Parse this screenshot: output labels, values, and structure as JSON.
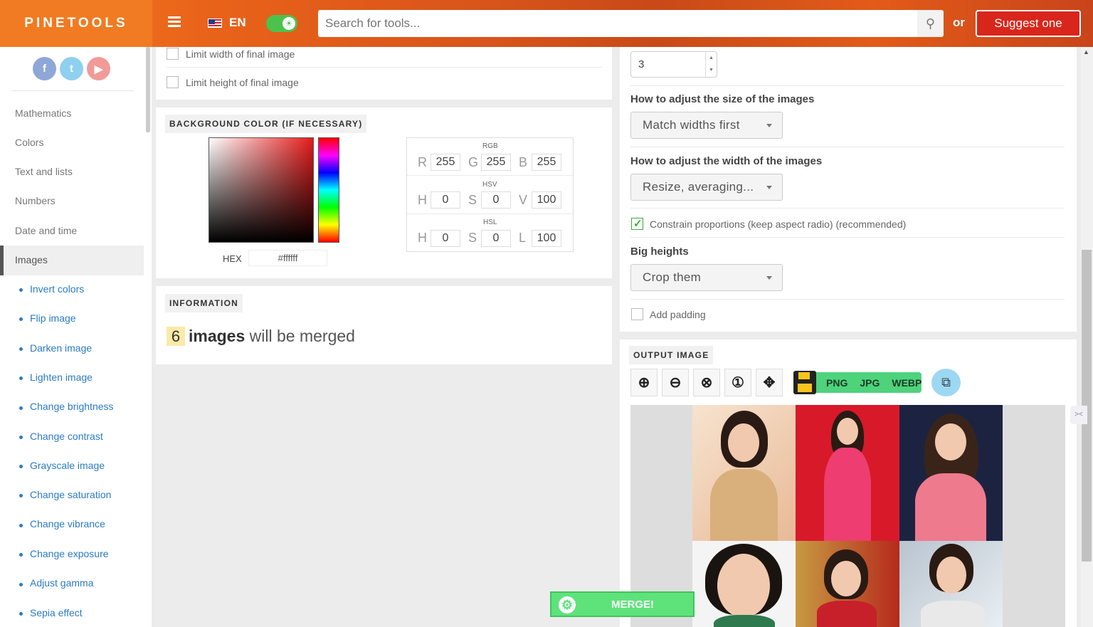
{
  "header": {
    "logo": "PINETOOLS",
    "lang": "EN",
    "search_placeholder": "Search for tools...",
    "or": "or",
    "suggest": "Suggest one"
  },
  "sidebar": {
    "categories": [
      "Mathematics",
      "Colors",
      "Text and lists",
      "Numbers",
      "Date and time"
    ],
    "active": "Images",
    "subitems": [
      "Invert colors",
      "Flip image",
      "Darken image",
      "Lighten image",
      "Change brightness",
      "Change contrast",
      "Grayscale image",
      "Change saturation",
      "Change vibrance",
      "Change exposure",
      "Adjust gamma",
      "Sepia effect"
    ]
  },
  "options_top": {
    "limit_width": "Limit width of final image",
    "limit_height": "Limit height of final image"
  },
  "background": {
    "title": "BACKGROUND COLOR (IF NECESSARY)",
    "hex_label": "HEX",
    "hex_value": "#ffffff",
    "rgb_label": "RGB",
    "hsv_label": "HSV",
    "hsl_label": "HSL",
    "r": "255",
    "g": "255",
    "b": "255",
    "hsv_h": "0",
    "hsv_s": "0",
    "hsv_v": "100",
    "hsl_h": "0",
    "hsl_s": "0",
    "hsl_l": "100",
    "letters": {
      "R": "R",
      "G": "G",
      "B": "B",
      "H": "H",
      "S": "S",
      "V": "V",
      "L": "L"
    },
    "selected_color": "#e51b1b"
  },
  "information": {
    "title": "INFORMATION",
    "count": "6",
    "count_word": "images",
    "suffix": "will be merged"
  },
  "right": {
    "columns_value": "3",
    "size_label": "How to adjust the size of the images",
    "size_value": "Match widths first",
    "width_label": "How to adjust the width of the images",
    "width_value": "Resize, averaging...",
    "constrain": "Constrain proportions (keep aspect radio) (recommended)",
    "big_heights_label": "Big heights",
    "big_heights_value": "Crop them",
    "add_padding": "Add padding",
    "output_title": "OUTPUT IMAGE",
    "formats": [
      "PNG",
      "JPG",
      "WEBP"
    ]
  },
  "merge_label": "MERGE!"
}
